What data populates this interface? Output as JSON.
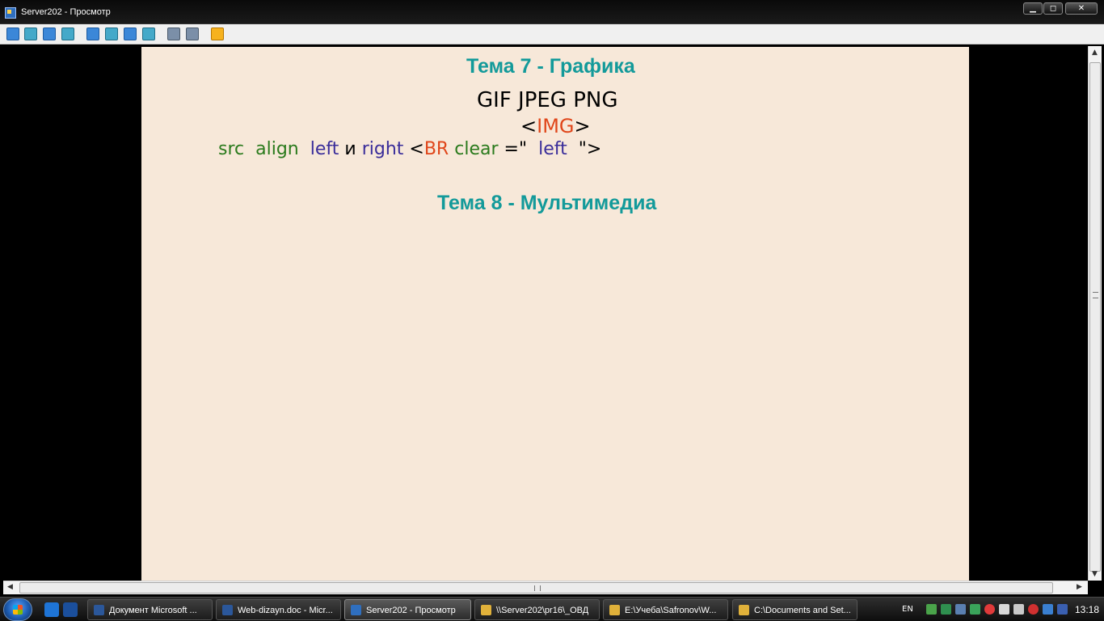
{
  "window": {
    "title": "Server202 - Просмотр",
    "minimize": "▁",
    "maximize": "◻",
    "close": "✕"
  },
  "toolbar": {
    "icons": [
      "monitor-icon",
      "chat-icon",
      "phone-icon",
      "message-icon",
      "window-icon",
      "fullscreen-icon",
      "square-icon",
      "fit-icon",
      "copy-icon",
      "tools-icon",
      "close-session-icon"
    ]
  },
  "slide": {
    "title1": "Тема 7 - Графика",
    "formats": "GIF JPEG PNG",
    "img_tag": {
      "open": "<",
      "name": "IMG",
      "close": ">"
    },
    "attrs": {
      "src": "src",
      "align": "align",
      "left": "left",
      "and": "и",
      "right": "right",
      "lt": "<",
      "br": "BR",
      "clear": "clear",
      "eq": "=\"",
      "left2": "left",
      "end": "\">"
    },
    "title2": "Тема 8 - Мультимедиа"
  },
  "taskbar": {
    "tasks": [
      {
        "label": "Документ Microsoft ...",
        "color": "#2b579a"
      },
      {
        "label": "Web-dizayn.doc - Micr...",
        "color": "#2b579a"
      },
      {
        "label": "Server202 - Просмотр",
        "color": "#2f6fbf"
      },
      {
        "label": "\\\\Server202\\pr16\\_ОВД",
        "color": "#e0b13a"
      },
      {
        "label": "E:\\Учеба\\Safronov\\W...",
        "color": "#e0b13a"
      },
      {
        "label": "C:\\Documents and Set...",
        "color": "#e0b13a"
      }
    ],
    "language": "EN",
    "clock": "13:18"
  },
  "colors": {
    "slide_bg": "#f7e8d9",
    "title": "#139a9a",
    "tag": "#e0461a",
    "attr_green": "#2a7a1c",
    "attr_purple": "#3a2d9a"
  }
}
